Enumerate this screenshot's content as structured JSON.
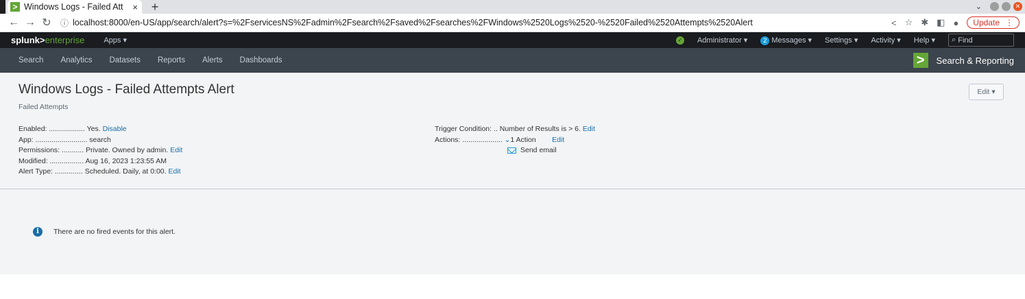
{
  "browser": {
    "tab_title": "Windows Logs - Failed Att",
    "tab_close": "×",
    "new_tab": "+",
    "url": "localhost:8000/en-US/app/search/alert?s=%2FservicesNS%2Fadmin%2Fsearch%2Fsaved%2Fsearches%2FWindows%2520Logs%2520-%2520Failed%2520Attempts%2520Alert",
    "update_label": "Update"
  },
  "splunk_bar": {
    "logo_main": "splunk>",
    "logo_ent": "enterprise",
    "apps_label": "Apps ▾",
    "user_label": "Administrator ▾",
    "messages_count": "2",
    "messages_label": "Messages ▾",
    "settings_label": "Settings ▾",
    "activity_label": "Activity ▾",
    "help_label": "Help ▾",
    "find_placeholder": "Find"
  },
  "app_nav": {
    "items": [
      "Search",
      "Analytics",
      "Datasets",
      "Reports",
      "Alerts",
      "Dashboards"
    ],
    "app_name": "Search & Reporting"
  },
  "alert": {
    "title": "Windows Logs - Failed Attempts Alert",
    "subtitle": "Failed Attempts",
    "edit_label": "Edit ▾",
    "enabled_label": "Enabled: ..................",
    "enabled_value": "Yes.",
    "enabled_link": "Disable",
    "app_label": "App: ..........................",
    "app_value": "search",
    "permissions_label": "Permissions: ...........",
    "permissions_value": "Private. Owned by admin.",
    "permissions_link": "Edit",
    "modified_label": "Modified: .................",
    "modified_value": "Aug 16, 2023 1:23:55 AM",
    "alert_type_label": "Alert Type: ..............",
    "alert_type_value": "Scheduled. Daily, at 0:00.",
    "alert_type_link": "Edit",
    "trigger_label": "Trigger Condition: ..",
    "trigger_value": "Number of Results is > 6.",
    "trigger_link": "Edit",
    "actions_label": "Actions: ....................",
    "actions_value": "1 Action",
    "actions_link": "Edit",
    "action_item": "Send email",
    "no_events_message": "There are no fired events for this alert."
  }
}
